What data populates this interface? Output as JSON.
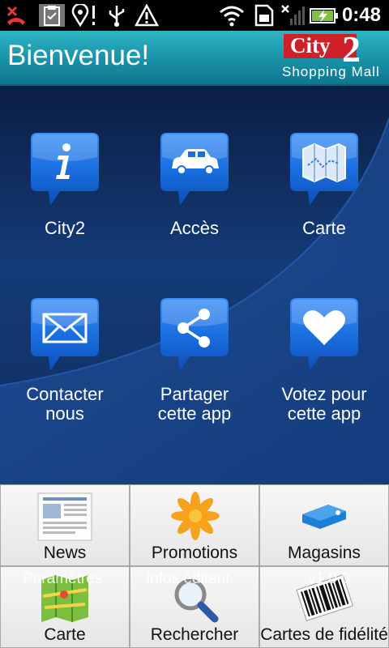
{
  "status_bar": {
    "time": "0:48",
    "icons": [
      "missed-call-icon",
      "clipboard-icon",
      "location-icon",
      "usb-icon",
      "warning-icon",
      "wifi-icon",
      "sim-icon",
      "no-signal-icon",
      "battery-charging-icon"
    ]
  },
  "header": {
    "title": "Bienvenue!",
    "logo_top": "City",
    "logo_num": "2",
    "logo_sub": "Shopping Mall"
  },
  "tiles": [
    {
      "label": "City2",
      "icon": "info-icon"
    },
    {
      "label": "Accès",
      "icon": "car-icon"
    },
    {
      "label": "Carte",
      "icon": "map-icon"
    },
    {
      "label_line1": "Contacter",
      "label_line2": "nous",
      "icon": "envelope-icon"
    },
    {
      "label_line1": "Partager",
      "label_line2": "cette app",
      "icon": "share-icon"
    },
    {
      "label_line1": "Votez pour",
      "label_line2": "cette app",
      "icon": "heart-icon"
    }
  ],
  "menu": {
    "items": [
      {
        "label": "News",
        "icon": "newspaper-icon"
      },
      {
        "label": "Promotions",
        "icon": "flower-icon"
      },
      {
        "label": "Magasins",
        "icon": "price-tag-icon"
      },
      {
        "label": "Carte",
        "icon": "folded-map-icon"
      },
      {
        "label": "Rechercher",
        "icon": "magnifier-icon"
      },
      {
        "label": "Cartes de fidélité",
        "icon": "barcode-icon"
      }
    ],
    "ghost_texts": [
      "Paramètres",
      "Infos éditeur",
      "v1.0.0"
    ]
  },
  "colors": {
    "header": "#1891a6",
    "tile_blue": "#1a6fe0",
    "logo_red": "#cf202a"
  }
}
